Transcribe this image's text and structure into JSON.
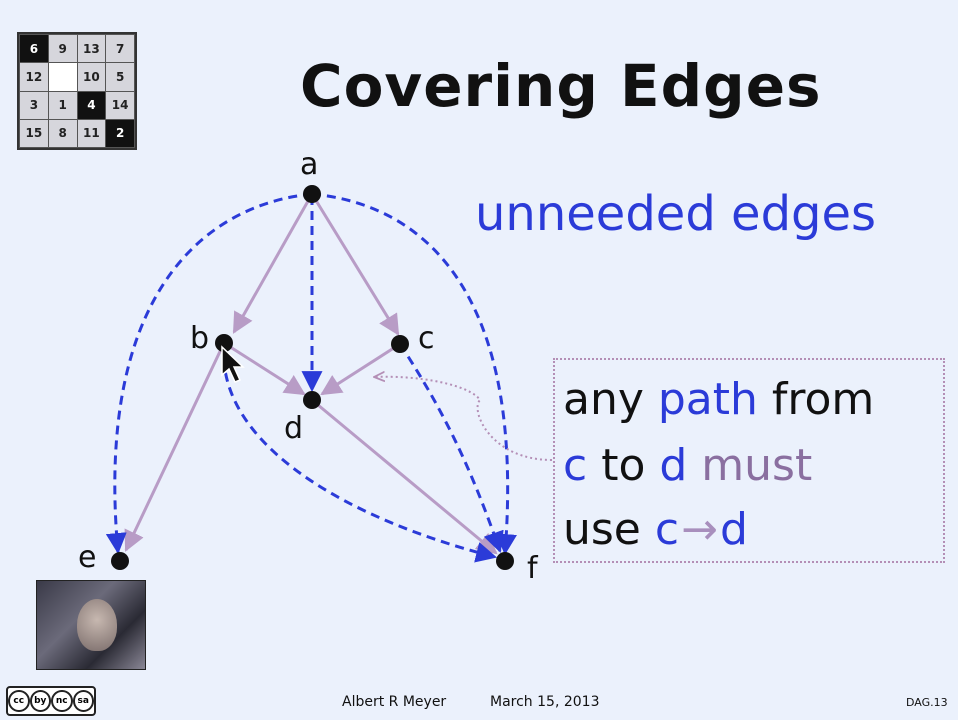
{
  "slide": {
    "title": "Covering Edges",
    "subtitle": "unneeded edges",
    "callout": {
      "line1_a": "any ",
      "line1_b": "path",
      "line1_c": " from",
      "line2_a": "c",
      "line2_b": " to ",
      "line2_c": "d",
      "line2_d": " must",
      "line3_a": "use ",
      "line3_b": "c",
      "line3_arrow": "→",
      "line3_c": "d"
    }
  },
  "graph": {
    "nodes": [
      {
        "id": "a",
        "label": "a"
      },
      {
        "id": "b",
        "label": "b"
      },
      {
        "id": "c",
        "label": "c"
      },
      {
        "id": "d",
        "label": "d"
      },
      {
        "id": "e",
        "label": "e"
      },
      {
        "id": "f",
        "label": "f"
      }
    ],
    "covering_edges": [
      [
        "a",
        "b"
      ],
      [
        "a",
        "c"
      ],
      [
        "b",
        "d"
      ],
      [
        "c",
        "d"
      ],
      [
        "b",
        "e"
      ],
      [
        "d",
        "f"
      ]
    ],
    "unneeded_edges": [
      [
        "a",
        "e"
      ],
      [
        "a",
        "d"
      ],
      [
        "a",
        "f"
      ],
      [
        "b",
        "f"
      ],
      [
        "c",
        "f"
      ]
    ],
    "colors": {
      "covering": "#b89cc6",
      "unneeded": "#2b3bd8",
      "node": "#111111"
    }
  },
  "puzzle": {
    "rows": [
      [
        "6",
        "9",
        "13",
        "7"
      ],
      [
        "12",
        "",
        "10",
        "5"
      ],
      [
        "3",
        "1",
        "4",
        "14"
      ],
      [
        "15",
        "8",
        "11",
        "2"
      ]
    ]
  },
  "footer": {
    "author": "Albert R Meyer",
    "date": "March 15, 2013",
    "slide_id": "DAG.13",
    "license_icons": [
      "cc",
      "by",
      "nc",
      "sa"
    ]
  }
}
